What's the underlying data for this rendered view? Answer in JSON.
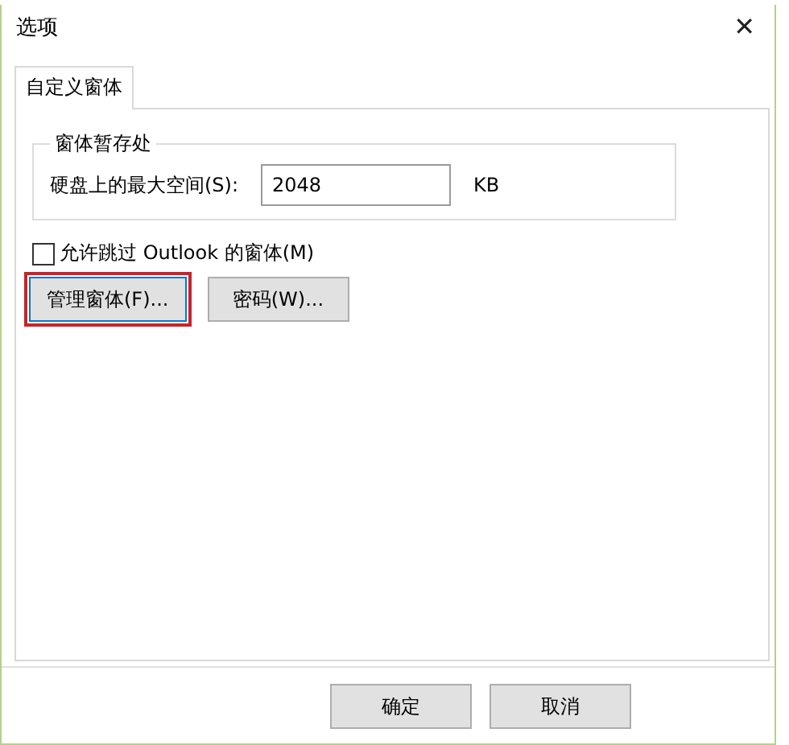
{
  "window": {
    "title": "选项",
    "close": "✕"
  },
  "tabs": [
    {
      "label": "自定义窗体",
      "selected": true
    }
  ],
  "group": {
    "title": "窗体暂存处",
    "label": "硬盘上的最大空间(S):",
    "value": "2048",
    "unit": "KB"
  },
  "checkbox": {
    "label": "允许跳过 Outlook 的窗体(M)",
    "checked": false
  },
  "buttons": [
    {
      "label": "管理窗体(F)...",
      "highlighted": true
    },
    {
      "label": "密码(W)...",
      "highlighted": false
    }
  ],
  "footer_buttons": [
    {
      "label": "确定"
    },
    {
      "label": "取消"
    }
  ]
}
